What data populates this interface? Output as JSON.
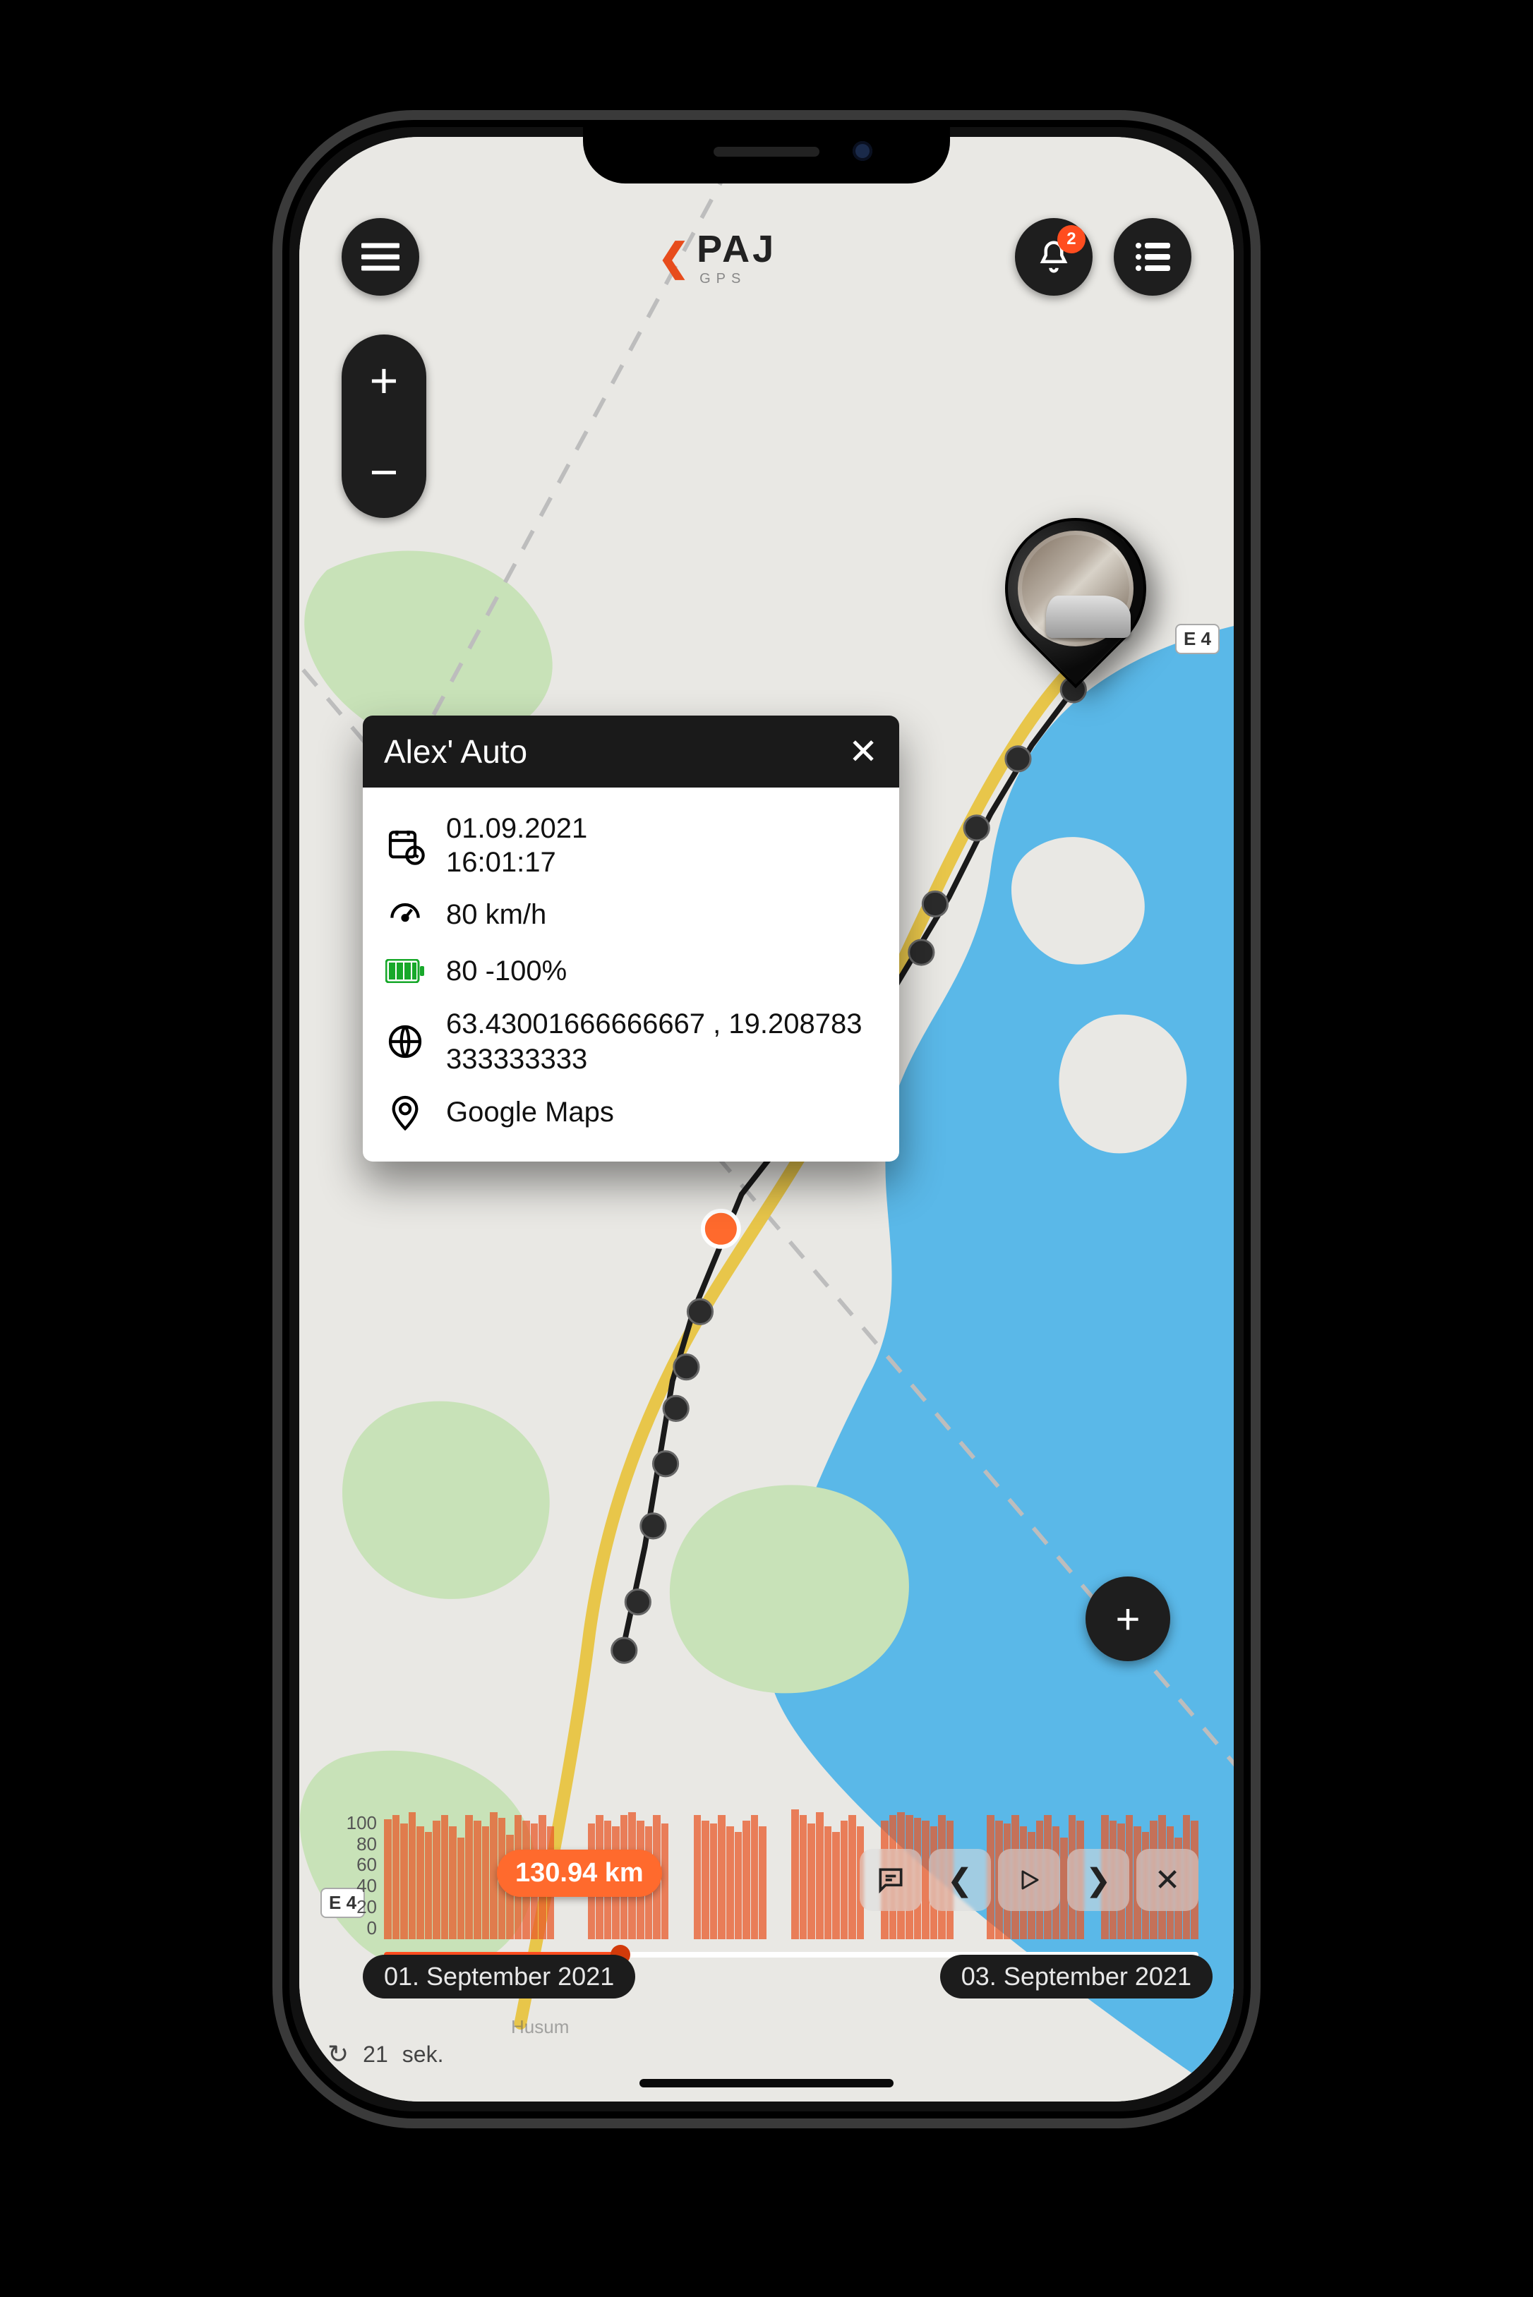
{
  "brand": {
    "name": "PAJ",
    "sub": "GPS"
  },
  "notifications": {
    "count": "2"
  },
  "popup": {
    "title": "Alex' Auto",
    "date": "01.09.2021",
    "time": "16:01:17",
    "speed": "80 km/h",
    "battery": "80 -100%",
    "coords": "63.43001666666667 , 19.208783333333333",
    "maps_link": "Google Maps"
  },
  "timeline": {
    "distance": "130.94 km",
    "start_label": "01. September 2021",
    "end_label": "03. September 2021",
    "yticks": [
      "100",
      "80",
      "60",
      "40",
      "20",
      "0"
    ]
  },
  "footer": {
    "refresh_value": "21",
    "refresh_unit": "sek."
  },
  "map": {
    "town": "Husum",
    "road": "E 4"
  },
  "colors": {
    "accent": "#ff4d1f",
    "water": "#5ab8e8"
  }
}
